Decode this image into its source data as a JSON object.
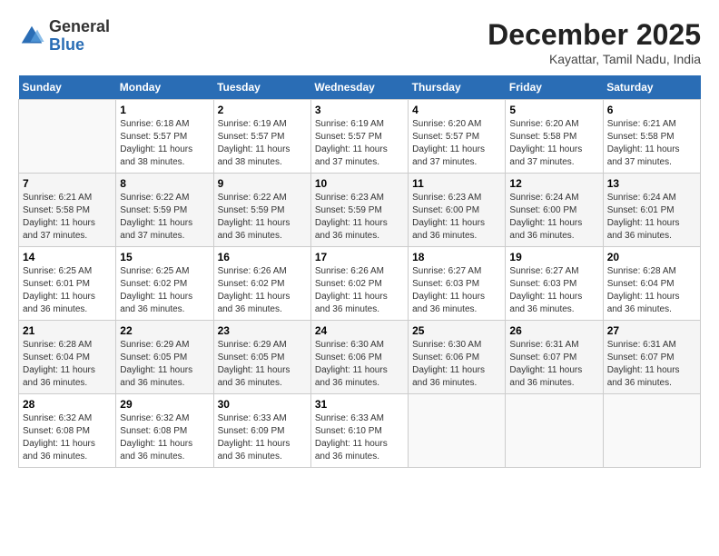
{
  "header": {
    "logo_general": "General",
    "logo_blue": "Blue",
    "month_year": "December 2025",
    "location": "Kayattar, Tamil Nadu, India"
  },
  "days_of_week": [
    "Sunday",
    "Monday",
    "Tuesday",
    "Wednesday",
    "Thursday",
    "Friday",
    "Saturday"
  ],
  "weeks": [
    [
      {
        "day": "",
        "sunrise": "",
        "sunset": "",
        "daylight": ""
      },
      {
        "day": "1",
        "sunrise": "Sunrise: 6:18 AM",
        "sunset": "Sunset: 5:57 PM",
        "daylight": "Daylight: 11 hours and 38 minutes."
      },
      {
        "day": "2",
        "sunrise": "Sunrise: 6:19 AM",
        "sunset": "Sunset: 5:57 PM",
        "daylight": "Daylight: 11 hours and 38 minutes."
      },
      {
        "day": "3",
        "sunrise": "Sunrise: 6:19 AM",
        "sunset": "Sunset: 5:57 PM",
        "daylight": "Daylight: 11 hours and 37 minutes."
      },
      {
        "day": "4",
        "sunrise": "Sunrise: 6:20 AM",
        "sunset": "Sunset: 5:57 PM",
        "daylight": "Daylight: 11 hours and 37 minutes."
      },
      {
        "day": "5",
        "sunrise": "Sunrise: 6:20 AM",
        "sunset": "Sunset: 5:58 PM",
        "daylight": "Daylight: 11 hours and 37 minutes."
      },
      {
        "day": "6",
        "sunrise": "Sunrise: 6:21 AM",
        "sunset": "Sunset: 5:58 PM",
        "daylight": "Daylight: 11 hours and 37 minutes."
      }
    ],
    [
      {
        "day": "7",
        "sunrise": "Sunrise: 6:21 AM",
        "sunset": "Sunset: 5:58 PM",
        "daylight": "Daylight: 11 hours and 37 minutes."
      },
      {
        "day": "8",
        "sunrise": "Sunrise: 6:22 AM",
        "sunset": "Sunset: 5:59 PM",
        "daylight": "Daylight: 11 hours and 37 minutes."
      },
      {
        "day": "9",
        "sunrise": "Sunrise: 6:22 AM",
        "sunset": "Sunset: 5:59 PM",
        "daylight": "Daylight: 11 hours and 36 minutes."
      },
      {
        "day": "10",
        "sunrise": "Sunrise: 6:23 AM",
        "sunset": "Sunset: 5:59 PM",
        "daylight": "Daylight: 11 hours and 36 minutes."
      },
      {
        "day": "11",
        "sunrise": "Sunrise: 6:23 AM",
        "sunset": "Sunset: 6:00 PM",
        "daylight": "Daylight: 11 hours and 36 minutes."
      },
      {
        "day": "12",
        "sunrise": "Sunrise: 6:24 AM",
        "sunset": "Sunset: 6:00 PM",
        "daylight": "Daylight: 11 hours and 36 minutes."
      },
      {
        "day": "13",
        "sunrise": "Sunrise: 6:24 AM",
        "sunset": "Sunset: 6:01 PM",
        "daylight": "Daylight: 11 hours and 36 minutes."
      }
    ],
    [
      {
        "day": "14",
        "sunrise": "Sunrise: 6:25 AM",
        "sunset": "Sunset: 6:01 PM",
        "daylight": "Daylight: 11 hours and 36 minutes."
      },
      {
        "day": "15",
        "sunrise": "Sunrise: 6:25 AM",
        "sunset": "Sunset: 6:02 PM",
        "daylight": "Daylight: 11 hours and 36 minutes."
      },
      {
        "day": "16",
        "sunrise": "Sunrise: 6:26 AM",
        "sunset": "Sunset: 6:02 PM",
        "daylight": "Daylight: 11 hours and 36 minutes."
      },
      {
        "day": "17",
        "sunrise": "Sunrise: 6:26 AM",
        "sunset": "Sunset: 6:02 PM",
        "daylight": "Daylight: 11 hours and 36 minutes."
      },
      {
        "day": "18",
        "sunrise": "Sunrise: 6:27 AM",
        "sunset": "Sunset: 6:03 PM",
        "daylight": "Daylight: 11 hours and 36 minutes."
      },
      {
        "day": "19",
        "sunrise": "Sunrise: 6:27 AM",
        "sunset": "Sunset: 6:03 PM",
        "daylight": "Daylight: 11 hours and 36 minutes."
      },
      {
        "day": "20",
        "sunrise": "Sunrise: 6:28 AM",
        "sunset": "Sunset: 6:04 PM",
        "daylight": "Daylight: 11 hours and 36 minutes."
      }
    ],
    [
      {
        "day": "21",
        "sunrise": "Sunrise: 6:28 AM",
        "sunset": "Sunset: 6:04 PM",
        "daylight": "Daylight: 11 hours and 36 minutes."
      },
      {
        "day": "22",
        "sunrise": "Sunrise: 6:29 AM",
        "sunset": "Sunset: 6:05 PM",
        "daylight": "Daylight: 11 hours and 36 minutes."
      },
      {
        "day": "23",
        "sunrise": "Sunrise: 6:29 AM",
        "sunset": "Sunset: 6:05 PM",
        "daylight": "Daylight: 11 hours and 36 minutes."
      },
      {
        "day": "24",
        "sunrise": "Sunrise: 6:30 AM",
        "sunset": "Sunset: 6:06 PM",
        "daylight": "Daylight: 11 hours and 36 minutes."
      },
      {
        "day": "25",
        "sunrise": "Sunrise: 6:30 AM",
        "sunset": "Sunset: 6:06 PM",
        "daylight": "Daylight: 11 hours and 36 minutes."
      },
      {
        "day": "26",
        "sunrise": "Sunrise: 6:31 AM",
        "sunset": "Sunset: 6:07 PM",
        "daylight": "Daylight: 11 hours and 36 minutes."
      },
      {
        "day": "27",
        "sunrise": "Sunrise: 6:31 AM",
        "sunset": "Sunset: 6:07 PM",
        "daylight": "Daylight: 11 hours and 36 minutes."
      }
    ],
    [
      {
        "day": "28",
        "sunrise": "Sunrise: 6:32 AM",
        "sunset": "Sunset: 6:08 PM",
        "daylight": "Daylight: 11 hours and 36 minutes."
      },
      {
        "day": "29",
        "sunrise": "Sunrise: 6:32 AM",
        "sunset": "Sunset: 6:08 PM",
        "daylight": "Daylight: 11 hours and 36 minutes."
      },
      {
        "day": "30",
        "sunrise": "Sunrise: 6:33 AM",
        "sunset": "Sunset: 6:09 PM",
        "daylight": "Daylight: 11 hours and 36 minutes."
      },
      {
        "day": "31",
        "sunrise": "Sunrise: 6:33 AM",
        "sunset": "Sunset: 6:10 PM",
        "daylight": "Daylight: 11 hours and 36 minutes."
      },
      {
        "day": "",
        "sunrise": "",
        "sunset": "",
        "daylight": ""
      },
      {
        "day": "",
        "sunrise": "",
        "sunset": "",
        "daylight": ""
      },
      {
        "day": "",
        "sunrise": "",
        "sunset": "",
        "daylight": ""
      }
    ]
  ]
}
